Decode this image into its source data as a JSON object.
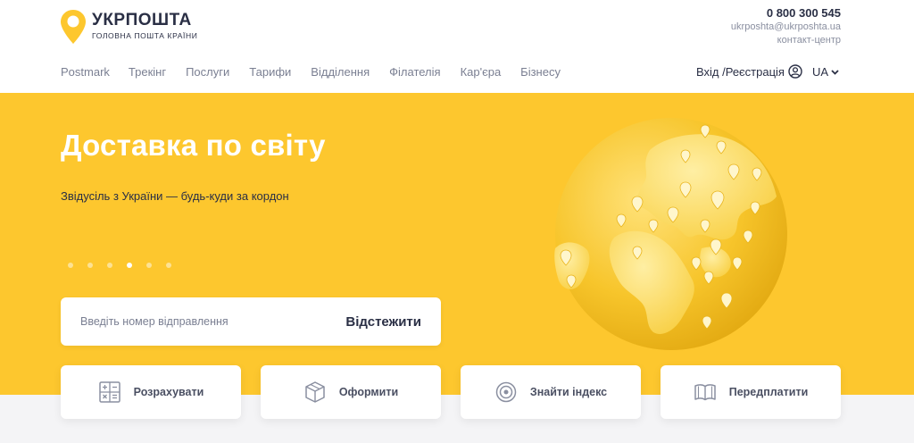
{
  "brand": {
    "name": "УКРПОШТА",
    "tagline": "ГОЛОВНА ПОШТА КРАЇНИ",
    "color": "#fdc72e"
  },
  "contacts": {
    "phone": "0 800 300 545",
    "email": "ukrposhta@ukrposhta.ua",
    "label": "контакт-центр"
  },
  "nav": {
    "items": [
      {
        "label": "Postmark"
      },
      {
        "label": "Трекінг"
      },
      {
        "label": "Послуги"
      },
      {
        "label": "Тарифи"
      },
      {
        "label": "Відділення"
      },
      {
        "label": "Філателія"
      },
      {
        "label": "Кар'єра"
      },
      {
        "label": "Бізнесу"
      }
    ],
    "login": "Вхід /Реєстрація",
    "lang": "UA"
  },
  "hero": {
    "title": "Доставка по світу",
    "subtitle": "Звідусіль з України — будь-куди за кордон",
    "slides_total": 6,
    "slide_active": 4
  },
  "tracking": {
    "placeholder": "Введіть номер відправлення",
    "button": "Відстежити"
  },
  "actions": [
    {
      "label": "Розрахувати",
      "icon": "calculator-icon"
    },
    {
      "label": "Оформити",
      "icon": "parcel-box-icon"
    },
    {
      "label": "Знайти індекс",
      "icon": "target-icon"
    },
    {
      "label": "Передплатити",
      "icon": "open-book-icon"
    }
  ]
}
